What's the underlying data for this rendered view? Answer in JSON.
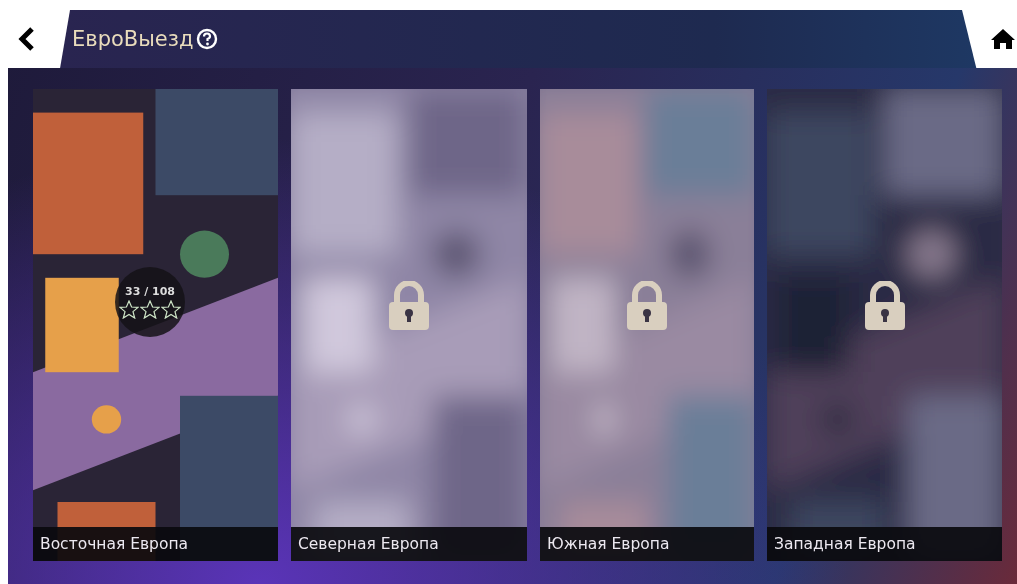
{
  "header": {
    "title": "ЕвроВыезд"
  },
  "regions": [
    {
      "name": "Восточная Европа",
      "locked": false,
      "progress": "33 / 108",
      "stars": 0
    },
    {
      "name": "Северная Европа",
      "locked": true
    },
    {
      "name": "Южная Европа",
      "locked": true
    },
    {
      "name": "Западная Европа",
      "locked": true
    }
  ]
}
